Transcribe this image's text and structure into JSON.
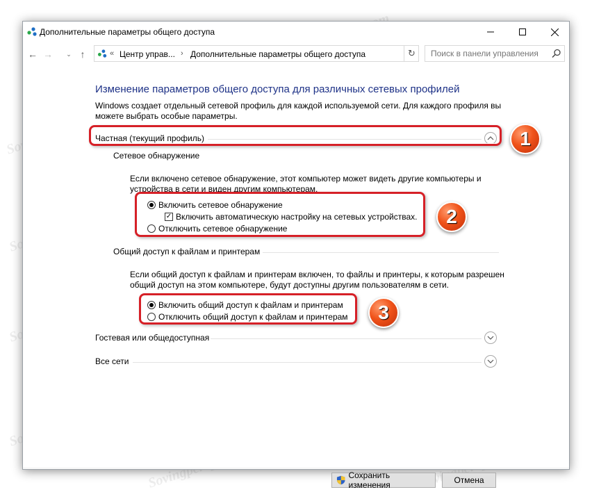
{
  "window": {
    "title": "Дополнительные параметры общего доступа"
  },
  "address": {
    "back_symbol": "←",
    "forward_symbol": "→",
    "history_symbol": "⌄",
    "up_symbol": "↑",
    "overflow": "«",
    "crumb1": "Центр управ...",
    "crumb2": "Дополнительные параметры общего доступа",
    "search_placeholder": "Поиск в панели управления"
  },
  "content": {
    "title": "Изменение параметров общего доступа для различных сетевых профилей",
    "intro": "Windows создает отдельный сетевой профиль для каждой используемой сети. Для каждого профиля вы можете выбрать особые параметры.",
    "private_section": {
      "header": "Частная (текущий профиль)",
      "discovery": {
        "header": "Сетевое обнаружение",
        "description": "Если включено сетевое обнаружение, этот компьютер может видеть другие компьютеры и устройства в сети и виден другим компьютерам.",
        "enable_label": "Включить сетевое обнаружение",
        "auto_setup_label": "Включить автоматическую настройку на сетевых устройствах.",
        "disable_label": "Отключить сетевое обнаружение"
      },
      "sharing": {
        "header": "Общий доступ к файлам и принтерам",
        "description": "Если общий доступ к файлам и принтерам включен, то файлы и принтеры, к которым разрешен общий доступ на этом компьютере, будут доступны другим пользователям в сети.",
        "enable_label": "Включить общий доступ к файлам и принтерам",
        "disable_label": "Отключить общий доступ к файлам и принтерам"
      }
    },
    "guest_section": {
      "header": "Гостевая или общедоступная"
    },
    "all_section": {
      "header": "Все сети"
    }
  },
  "annotations": {
    "badge1": "1",
    "badge2": "2",
    "badge3": "3"
  },
  "watermark": "Sovingpcrepair.com",
  "footer": {
    "save_label": "Сохранить изменения",
    "cancel_label": "Отмена"
  },
  "colors": {
    "title_blue": "#1e3287",
    "highlight_red": "#d62027",
    "badge_orange": "#f0531a"
  }
}
